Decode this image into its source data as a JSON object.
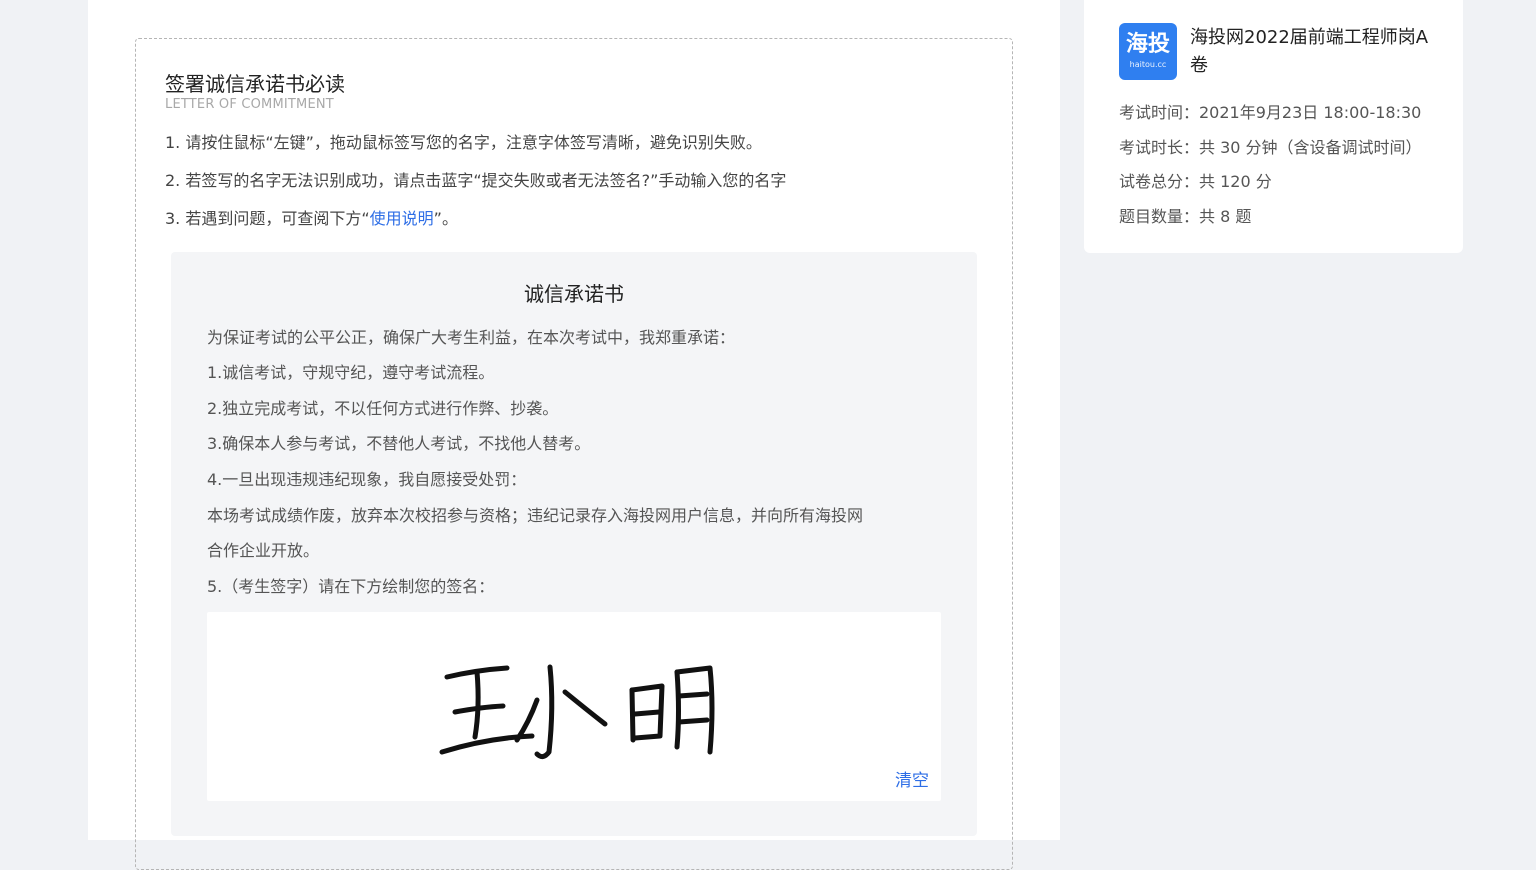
{
  "intro": {
    "title": "签署诚信承诺书必读",
    "subtitle": "LETTER OF COMMITMENT",
    "line1": "1. 请按住鼠标“左键”，拖动鼠标签写您的名字，注意字体签写清晰，避免识别失败。",
    "line2": "2. 若签写的名字无法识别成功，请点击蓝字“提交失败或者无法签名?”手动输入您的名字",
    "line3_prefix": "3. 若遇到问题，可查阅下方“",
    "line3_link": "使用说明",
    "line3_suffix": "”。"
  },
  "letter": {
    "title": "诚信承诺书",
    "lines": [
      "为保证考试的公平公正，确保广大考生利益，在本次考试中，我郑重承诺：",
      "1.诚信考试，守规守纪，遵守考试流程。",
      "2.独立完成考试，不以任何方式进行作弊、抄袭。",
      "3.确保本人参与考试，不替他人考试，不找他人替考。",
      "4.一旦出现违规违纪现象，我自愿接受处罚：",
      "本场考试成绩作废，放弃本次校招参与资格；违纪记录存入海投网用户信息，并向所有海投网",
      "合作企业开放。",
      "5.（考生签字）请在下方绘制您的签名："
    ],
    "signature": "王小明",
    "clear_label": "清空"
  },
  "exam": {
    "logo_text": "海投",
    "logo_sub": "haitou.cc",
    "title": "海投网2022届前端工程师岗A卷",
    "time": "考试时间：2021年9月23日 18:00-18:30",
    "duration": "考试时长：共 30 分钟（含设备调试时间）",
    "total_score": "试卷总分：共 120 分",
    "question_count": "题目数量：共 8 题"
  },
  "colors": {
    "accent": "#2e6ee6",
    "logo_bg": "#2f7ff0",
    "page_bg": "#f0f2f5",
    "panel_bg": "#f4f5f7"
  }
}
